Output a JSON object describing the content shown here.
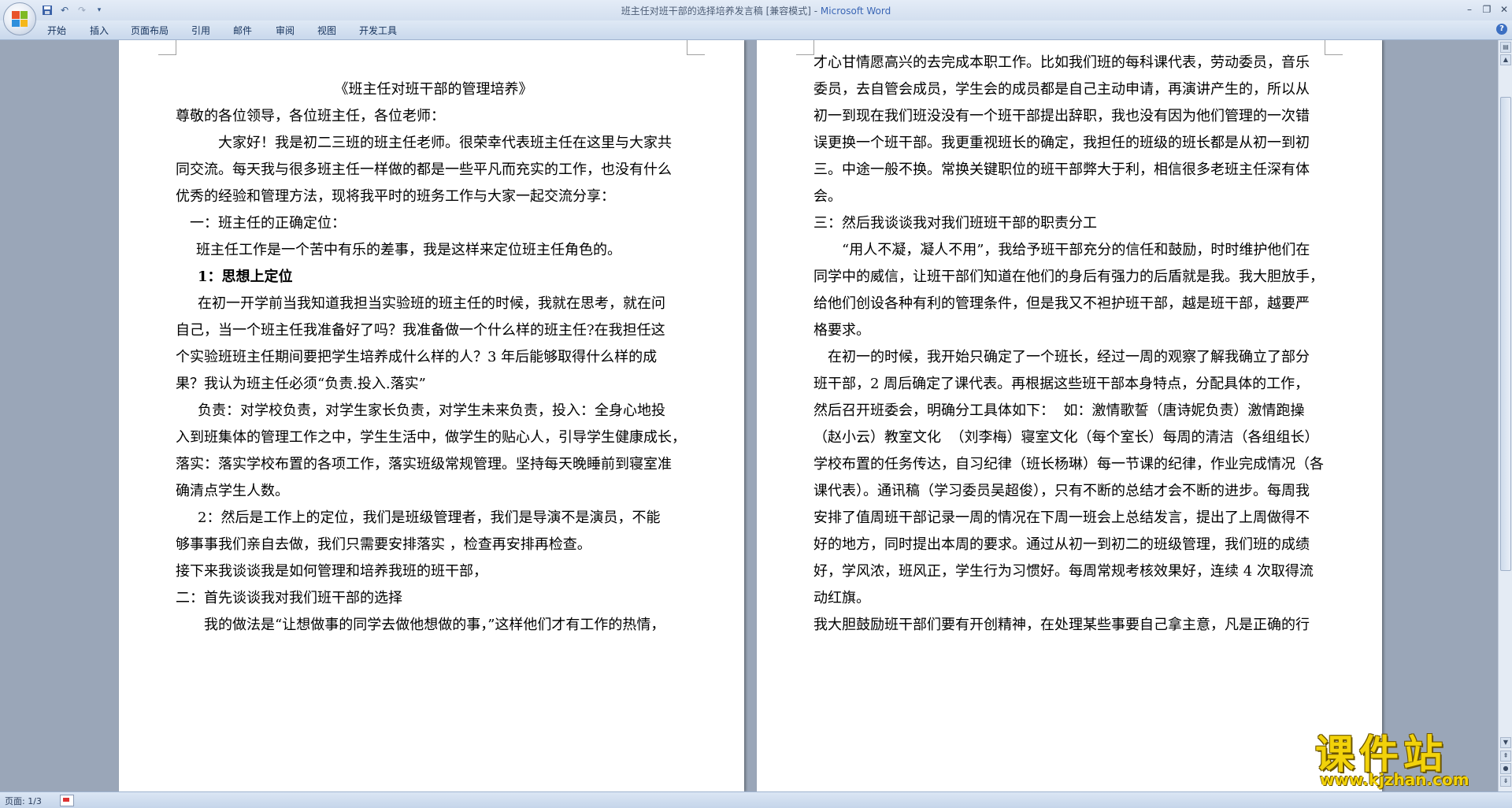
{
  "window": {
    "title_doc": "班主任对班干部的选择培养发言稿 [兼容模式] - ",
    "title_app": "Microsoft Word"
  },
  "ribbon": {
    "tabs": [
      "开始",
      "插入",
      "页面布局",
      "引用",
      "邮件",
      "审阅",
      "视图",
      "开发工具"
    ]
  },
  "status": {
    "page": "页面: 1/3"
  },
  "watermark": {
    "title": "课件站",
    "url": "www.kjzhan.com"
  },
  "page1": {
    "lines": [
      "",
      "《班主任对班干部的管理培养》",
      "尊敬的各位领导，各位班主任，各位老师：",
      "大家好！我是初二三班的班主任老师。很荣幸代表班主任在这里与大家共",
      "同交流。每天我与很多班主任一样做的都是一些平凡而充实的工作，也没有什么",
      "优秀的经验和管理方法，现将我平时的班务工作与大家一起交流分享：",
      "一：班主任的正确定位：",
      "班主任工作是一个苦中有乐的差事，我是这样来定位班主任角色的。",
      "1：思想上定位",
      "在初一开学前当我知道我担当实验班的班主任的时候，我就在思考，就在问",
      "自己，当一个班主任我准备好了吗？我准备做一个什么样的班主任?在我担任这",
      "个实验班班主任期间要把学生培养成什么样的人？3 年后能够取得什么样的成",
      "果？我认为班主任必须“负责.投入.落实”",
      "负责：对学校负责，对学生家长负责，对学生未来负责，投入：全身心地投",
      "入到班集体的管理工作之中，学生生活中，做学生的贴心人，引导学生健康成长，",
      "落实：落实学校布置的各项工作，落实班级常规管理。坚持每天晚睡前到寝室准",
      "确清点学生人数。",
      "2：然后是工作上的定位，我们是班级管理者，我们是导演不是演员，不能",
      "够事事我们亲自去做，我们只需要安排落实 ，检查再安排再检查。",
      "接下来我谈谈我是如何管理和培养我班的班干部，",
      "二：首先谈谈我对我们班干部的选择",
      "我的做法是“让想做事的同学去做他想做的事，”这样他们才有工作的热情，"
    ]
  },
  "page2": {
    "lines": [
      "才心甘情愿高兴的去完成本职工作。比如我们班的每科课代表，劳动委员，音乐",
      "委员，去自管会成员，学生会的成员都是自己主动申请，再演讲产生的，所以从",
      "初一到现在我们班没没有一个班干部提出辞职，我也没有因为他们管理的一次错",
      "误更换一个班干部。我更重视班长的确定，我担任的班级的班长都是从初一到初",
      "三。中途一般不换。常换关键职位的班干部弊大于利，相信很多老班主任深有体",
      "会。",
      "三：然后我谈谈我对我们班班干部的职责分工",
      "“用人不凝，凝人不用”，我给予班干部充分的信任和鼓励，时时维护他们在",
      "同学中的威信，让班干部们知道在他们的身后有强力的后盾就是我。我大胆放手，",
      "给他们创设各种有利的管理条件，但是我又不袒护班干部，越是班干部，越要严",
      "格要求。",
      "在初一的时候，我开始只确定了一个班长，经过一周的观察了解我确立了部分",
      "班干部，2 周后确定了课代表。再根据这些班干部本身特点，分配具体的工作，",
      "然后召开班委会，明确分工具体如下：  如：激情歌誓（唐诗妮负责）激情跑操",
      "（赵小云）教室文化  （刘李梅）寝室文化（每个室长）每周的清洁（各组组长）",
      "学校布置的任务传达，自习纪律（班长杨琳）每一节课的纪律，作业完成情况（各",
      "课代表）。通讯稿（学习委员吴超俊），只有不断的总结才会不断的进步。每周我",
      "安排了值周班干部记录一周的情况在下周一班会上总结发言，提出了上周做得不",
      "好的地方，同时提出本周的要求。通过从初一到初二的班级管理，我们班的成绩",
      "好，学风浓，班风正，学生行为习惯好。每周常规考核效果好，连续 4 次取得流",
      "动红旗。",
      "我大胆鼓励班干部们要有开创精神，在处理某些事要自己拿主意，凡是正确的行"
    ]
  }
}
